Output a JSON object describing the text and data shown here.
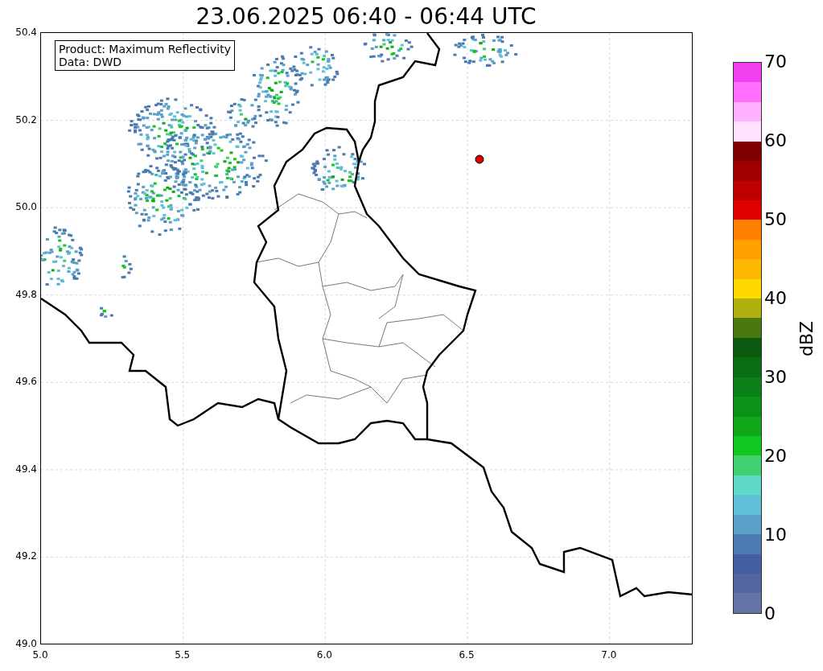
{
  "title": "23.06.2025 06:40 - 06:44 UTC",
  "map": {
    "legend": [
      "Product: Maximum Reflectivity",
      "Data: DWD"
    ],
    "y_ticks": [
      "50.4",
      "50.2",
      "50.0",
      "49.8",
      "49.6",
      "49.4",
      "49.2",
      "49.0"
    ],
    "x_ticks": [
      "5.0",
      "5.5",
      "6.0",
      "6.5",
      "7.0"
    ]
  },
  "colorbar": {
    "label": "dBZ",
    "ticks": [
      "70",
      "60",
      "50",
      "40",
      "30",
      "20",
      "10",
      "0"
    ],
    "segments": [
      {
        "color": "#f040f0"
      },
      {
        "color": "#ff70ff"
      },
      {
        "color": "#ffb0ff"
      },
      {
        "color": "#ffe0ff"
      },
      {
        "color": "#800000"
      },
      {
        "color": "#a00000"
      },
      {
        "color": "#c00000"
      },
      {
        "color": "#e00000"
      },
      {
        "color": "#ff8000"
      },
      {
        "color": "#ffa000"
      },
      {
        "color": "#ffb800"
      },
      {
        "color": "#ffd800"
      },
      {
        "color": "#b0b010"
      },
      {
        "color": "#4a7810"
      },
      {
        "color": "#0a5a10"
      },
      {
        "color": "#0a6e14"
      },
      {
        "color": "#0c8018"
      },
      {
        "color": "#0c9018"
      },
      {
        "color": "#10a818"
      },
      {
        "color": "#10c820"
      },
      {
        "color": "#40d070"
      },
      {
        "color": "#60d8c8"
      },
      {
        "color": "#60c0d8"
      },
      {
        "color": "#5aa0c8"
      },
      {
        "color": "#4a7ab0"
      },
      {
        "color": "#4560a0"
      },
      {
        "color": "#5466a0"
      },
      {
        "color": "#6373a6"
      }
    ]
  }
}
